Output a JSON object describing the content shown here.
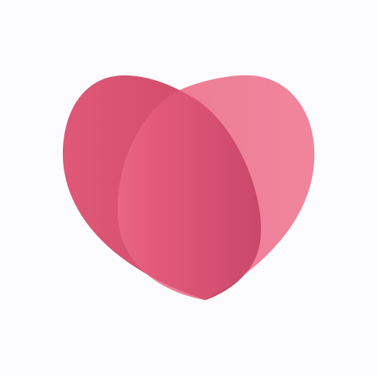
{
  "logo": {
    "icon": "heart-icon",
    "colors": {
      "left_lobe_dark": "#c64663",
      "left_lobe_mid": "#de5677",
      "right_lobe_light": "#ef8098",
      "overlap_light": "#ec7190",
      "overlap_dark": "#cc4b69"
    }
  }
}
